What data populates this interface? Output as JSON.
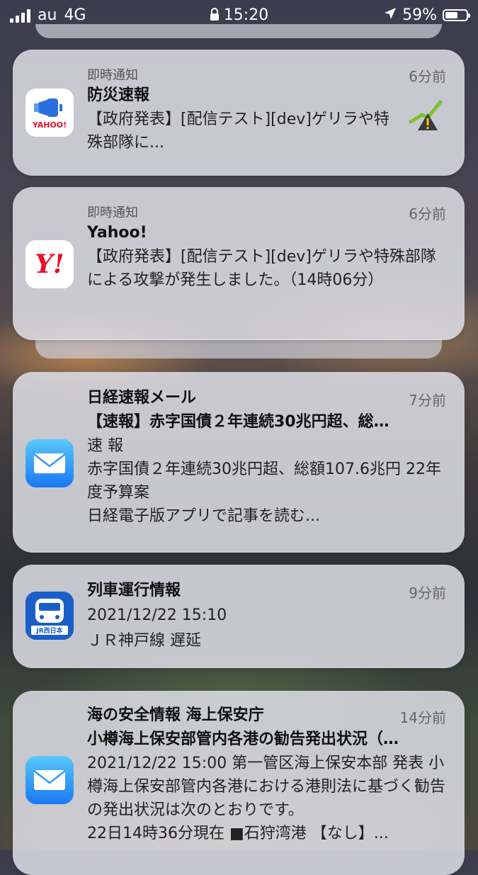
{
  "status_bar": {
    "carrier": "au",
    "network": "4G",
    "time": "15:20",
    "battery": "59%",
    "battery_level": 0.59
  },
  "notifications": [
    {
      "category": "即時通知",
      "time": "6分前",
      "title": "防災速報",
      "body": "【政府発表】[配信テスト][dev]ゲリラや特殊部隊に...",
      "icon": "yahoo-japan-megaphone-icon"
    },
    {
      "category": "即時通知",
      "time": "6分前",
      "title": "Yahoo!",
      "body": "【政府発表】[配信テスト][dev]ゲリラや特殊部隊による攻撃が発生しました。（14時06分）",
      "icon": "yahoo-y-icon"
    },
    {
      "time": "7分前",
      "title": "日経速報メール",
      "subtitle": "【速報】赤字国債２年連続30兆円超、総…",
      "body": "速 報\n赤字国債２年連続30兆円超、総額107.6兆円 22年度予算案\n日経電子版アプリで記事を読む...",
      "icon": "mail-icon"
    },
    {
      "time": "9分前",
      "title": "列車運行情報",
      "body": "2021/12/22 15:10\nＪＲ神戸線 遅延",
      "icon": "jr-west-train-icon"
    },
    {
      "time": "14分前",
      "title": "海の安全情報 海上保安庁",
      "subtitle": "小樽海上保安部管内各港の勧告発出状況（…",
      "body": "2021/12/22 15:00 第一管区海上保安本部 発表 小樽海上保安部管内各港における港則法に基づく勧告の発出状況は次のとおりです。\n22日14時36分現在 ■石狩湾港 【なし】...",
      "icon": "mail-icon"
    }
  ]
}
